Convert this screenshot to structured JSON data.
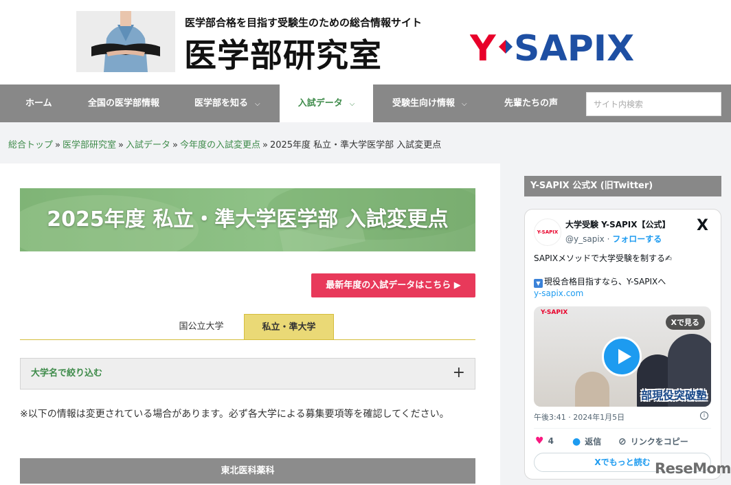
{
  "header": {
    "tagline": "医学部合格を目指す受験生のための総合情報サイト",
    "site_name": "医学部研究室",
    "logo_text": "Y-SAPIX"
  },
  "nav": {
    "items": [
      {
        "label": "ホーム"
      },
      {
        "label": "全国の医学部情報"
      },
      {
        "label": "医学部を知る",
        "dropdown": true
      },
      {
        "label": "入試データ",
        "dropdown": true,
        "active": true
      },
      {
        "label": "受験生向け情報",
        "dropdown": true
      },
      {
        "label": "先輩たちの声"
      }
    ],
    "search_placeholder": "サイト内検索"
  },
  "breadcrumb": {
    "links": [
      "総合トップ",
      "医学部研究室",
      "入試データ",
      "今年度の入試変更点"
    ],
    "separator": "»",
    "current": "2025年度 私立・準大学医学部 入試変更点"
  },
  "main": {
    "page_title": "2025年度 私立・準大学医学部 入試変更点",
    "latest_button": "最新年度の入試データはこちら ▶",
    "tabs": [
      {
        "label": "国公立大学",
        "active": false
      },
      {
        "label": "私立・準大学",
        "active": true
      }
    ],
    "filter_label": "大学名で絞り込む",
    "filter_icon": "+",
    "note": "※以下の情報は変更されている場合があります。必ず各大学による募集要項等を確認してください。",
    "university_heading": "東北医科薬科"
  },
  "sidebar": {
    "title": "Y-SAPIX 公式X (旧Twitter)",
    "post": {
      "avatar_text": "Y-SAPIX",
      "account_name": "大学受験 Y-SAPIX【公式】",
      "handle": "@y_sapix",
      "follow_sep": " · ",
      "follow_label": "フォローする",
      "x_logo": "X",
      "line1": "SAPIXメソッドで大学受験を制する✍",
      "line2_icon": "▼",
      "line2": "現役合格目指すなら、Y-SAPIXへ",
      "link": "y-sapix.com",
      "media_brand": "Y-SAPIX",
      "media_badge": "Xで見る",
      "media_caption": "部現役突破塾",
      "timestamp": "午後3:41 · 2024年1月5日",
      "info_icon": "i",
      "likes": "4",
      "reply_label": "返信",
      "copy_link_label": "リンクをコピー",
      "read_more": "Xでもっと読む"
    }
  },
  "watermark": "ReseMom",
  "colors": {
    "nav_bg": "#888888",
    "accent_green": "#3e8b4a",
    "button_red": "#e8395a",
    "tab_yellow": "#ead976",
    "x_blue": "#1d9bf0",
    "logo_red": "#e8002a",
    "logo_blue": "#1e4fa3"
  }
}
